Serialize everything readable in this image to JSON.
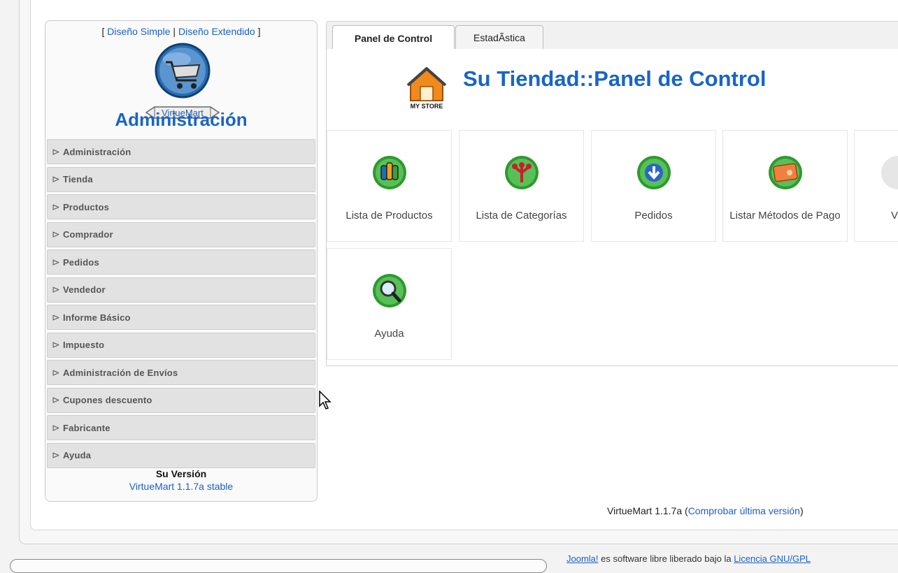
{
  "layout_toggle": {
    "open": "[ ",
    "simple": "Diseño Simple",
    "sep": " | ",
    "extended": "Diseño Extendido",
    "close": " ]"
  },
  "logo": {
    "text": "VirtueMart"
  },
  "sidebar": {
    "title": "Administración",
    "items": [
      {
        "label": "Administración"
      },
      {
        "label": "Tienda"
      },
      {
        "label": "Productos"
      },
      {
        "label": "Comprador"
      },
      {
        "label": "Pedidos"
      },
      {
        "label": "Vendedor"
      },
      {
        "label": "Informe Básico"
      },
      {
        "label": "Impuesto"
      },
      {
        "label": "Administración de Envíos"
      },
      {
        "label": "Cupones descuento"
      },
      {
        "label": "Fabricante"
      },
      {
        "label": "Ayuda"
      }
    ],
    "version_label": "Su Versión",
    "version_value": "VirtueMart 1.1.7a stable"
  },
  "tabs": [
    {
      "label": "Panel de Control",
      "active": true
    },
    {
      "label": "EstadÃ­stica",
      "active": false
    }
  ],
  "panel": {
    "store_icon_text": "MY STORE",
    "title": "Su Tiendad::Panel de Control",
    "tiles": [
      {
        "label": "Lista de Productos",
        "icon": "products-icon"
      },
      {
        "label": "Lista de Categorías",
        "icon": "categories-icon"
      },
      {
        "label": "Pedidos",
        "icon": "orders-icon"
      },
      {
        "label": "Listar Métodos de Pago",
        "icon": "payment-methods-icon"
      },
      {
        "label": "V",
        "icon": "vendor-icon"
      },
      {
        "label": "Ayuda",
        "icon": "help-icon"
      }
    ]
  },
  "footer": {
    "version_text": "VirtueMart 1.1.7a (",
    "check_link": "Comprobar última versión",
    "close_paren": ")"
  },
  "bottom": {
    "link1": "Joomla!",
    "text": " es software libre liberado bajo la ",
    "link2": "Licencia GNU/GPL"
  },
  "colors": {
    "accent": "#1865c7",
    "link": "#1a5fc8",
    "menu_bg": "#e2e2e2"
  }
}
